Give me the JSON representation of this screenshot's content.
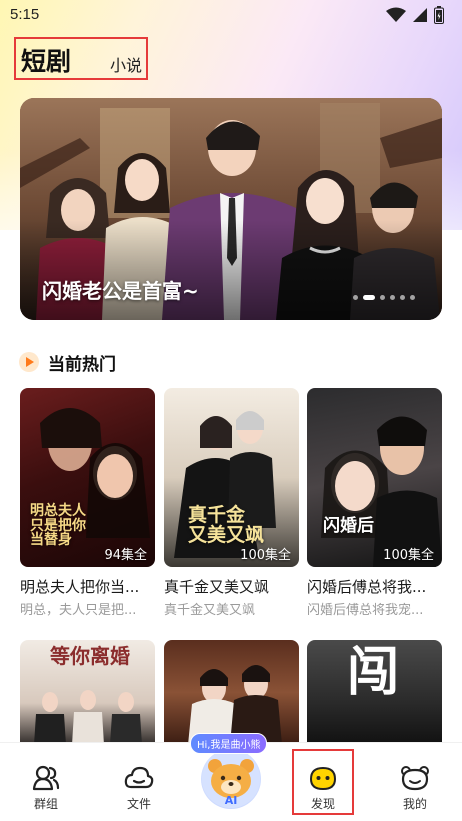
{
  "status_bar": {
    "time": "5:15",
    "icons": [
      "wifi-icon",
      "signal-icon",
      "battery-icon"
    ]
  },
  "header": {
    "tabs": [
      {
        "label": "短剧",
        "active": true
      },
      {
        "label": "小说",
        "active": false
      }
    ]
  },
  "banner": {
    "title": "闪婚老公是首富~",
    "dots_total": 6,
    "active_dot": 1
  },
  "section": {
    "icon": "play-icon",
    "title": "当前热门"
  },
  "cards": [
    {
      "title": "明总夫人把你当...",
      "subtitle": "明总，夫人只是把...",
      "episodes": "94集全",
      "cover_text": "明总夫人\n只是把你\n当替身"
    },
    {
      "title": "真千金又美又飒",
      "subtitle": "真千金又美又飒",
      "episodes": "100集全",
      "cover_text": "真千金\n又美又飒"
    },
    {
      "title": "闪婚后傅总将我...",
      "subtitle": "闪婚后傅总将我宠...",
      "episodes": "100集全",
      "cover_text": "闪婚后"
    }
  ],
  "second_row_cover_texts": [
    "等你离婚",
    "",
    "闯"
  ],
  "ai_assistant": {
    "bubble": "Hi,我是曲小熊",
    "label": "AI"
  },
  "bottom_nav": [
    {
      "label": "群组",
      "icon": "group-icon",
      "active": false
    },
    {
      "label": "文件",
      "icon": "cloud-file-icon",
      "active": false
    },
    {
      "label": "发现",
      "icon": "discover-smiley-icon",
      "active": true
    },
    {
      "label": "我的",
      "icon": "profile-bear-icon",
      "active": false
    }
  ],
  "colors": {
    "highlight_border": "#e53a3a",
    "accent_yellow": "#ffd400",
    "ai_blue": "#3f6cff"
  }
}
